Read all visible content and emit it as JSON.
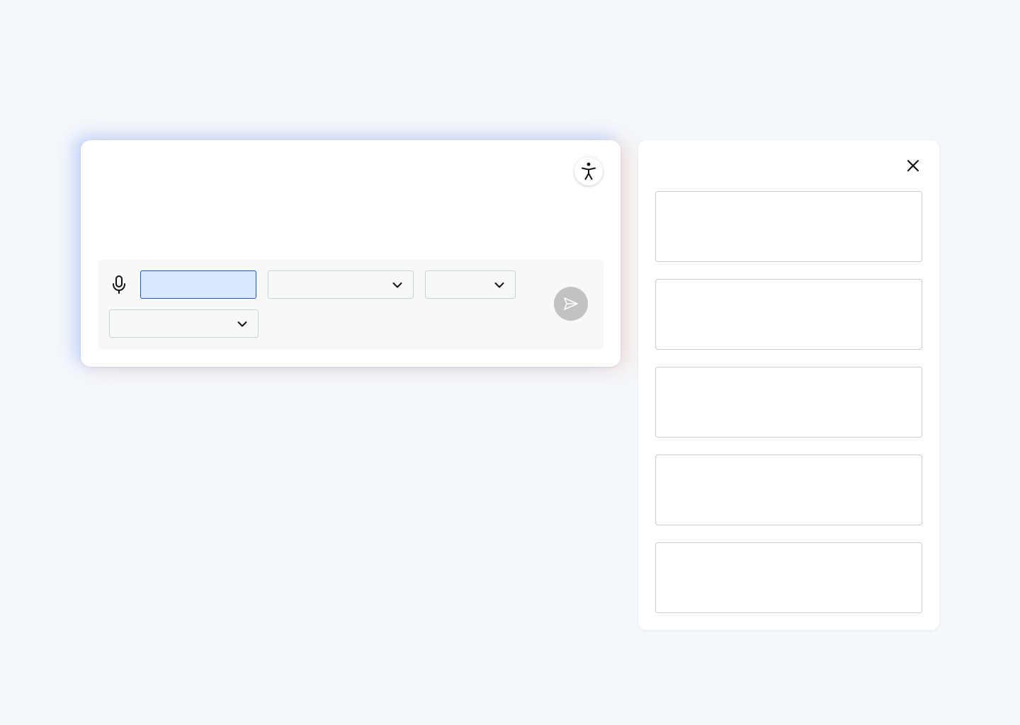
{
  "composer": {
    "input_value": "",
    "input_placeholder": "",
    "select_1_value": "",
    "select_2_value": "",
    "select_3_value": "",
    "icons": {
      "accessibility": "accessibility-icon",
      "microphone": "microphone-icon",
      "send": "send-icon",
      "chevron": "chevron-down-icon"
    },
    "colors": {
      "input_fill": "#dbe8fd",
      "input_border": "#1a56c8",
      "send_disabled": "#c2c2c2"
    }
  },
  "side_panel": {
    "close_icon": "close-icon",
    "cards": [
      {
        "text": ""
      },
      {
        "text": ""
      },
      {
        "text": ""
      },
      {
        "text": ""
      },
      {
        "text": ""
      }
    ]
  }
}
